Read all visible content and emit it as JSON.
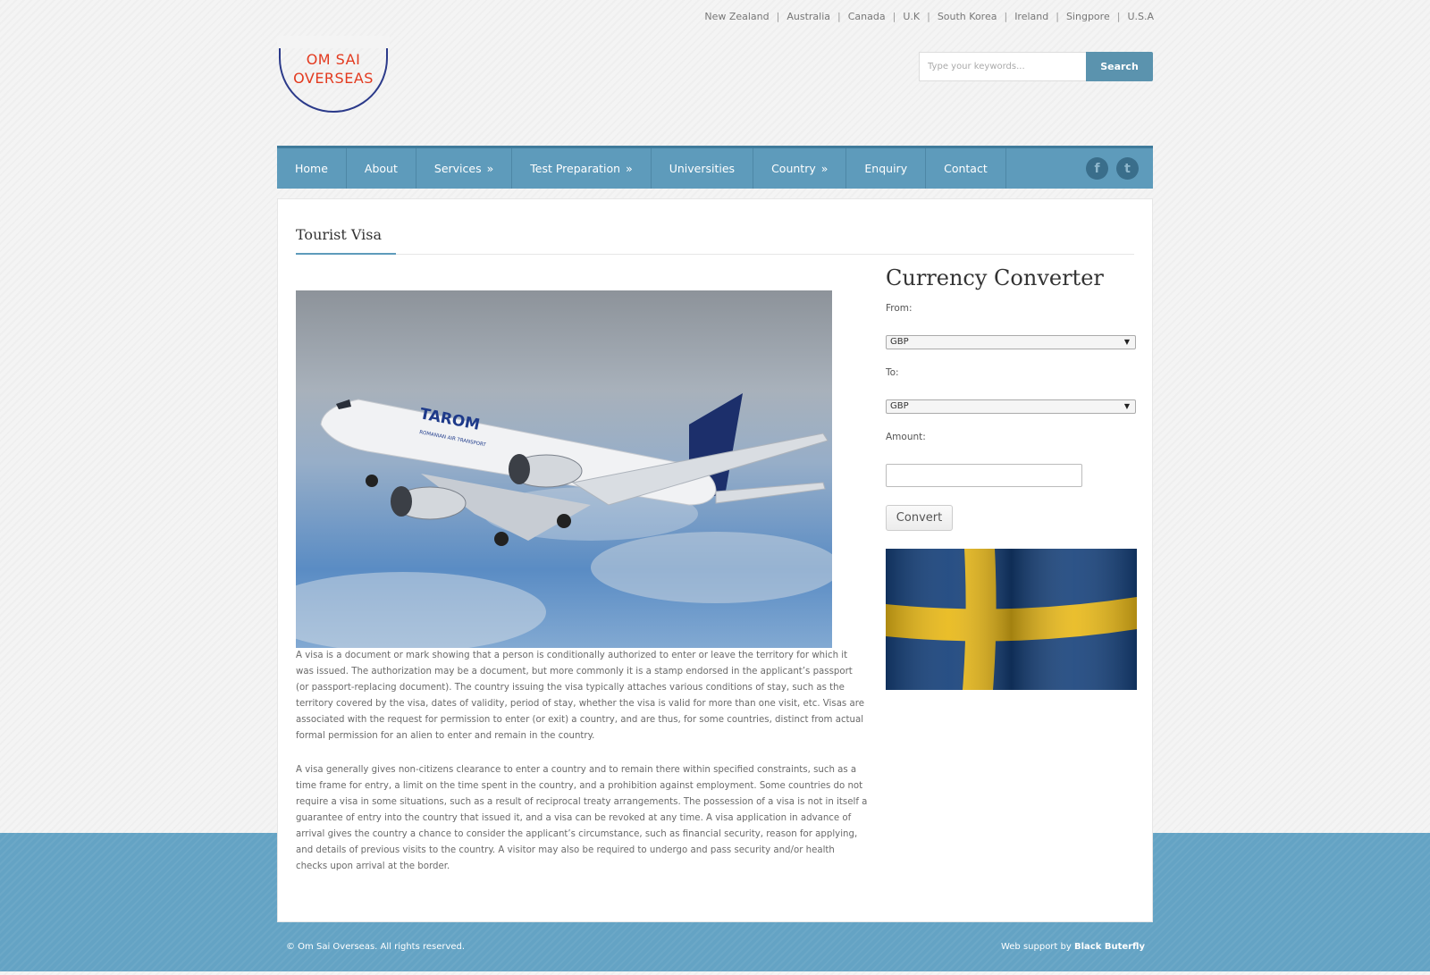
{
  "top_countries": [
    "New Zealand",
    "Australia",
    "Canada",
    "U.K",
    "South Korea",
    "Ireland",
    "Singpore",
    "U.S.A"
  ],
  "logo": {
    "text": "OM SAI\nOVERSEAS"
  },
  "search": {
    "placeholder": "Type your keywords...",
    "button_label": "Search"
  },
  "nav": {
    "items": [
      {
        "label": "Home",
        "arrow": ""
      },
      {
        "label": "About",
        "arrow": ""
      },
      {
        "label": "Services",
        "arrow": "»"
      },
      {
        "label": "Test Preparation",
        "arrow": "»"
      },
      {
        "label": "Universities",
        "arrow": ""
      },
      {
        "label": "Country",
        "arrow": "»"
      },
      {
        "label": "Enquiry",
        "arrow": ""
      },
      {
        "label": "Contact",
        "arrow": ""
      }
    ],
    "social": [
      {
        "icon": "facebook-icon",
        "glyph": "f"
      },
      {
        "icon": "twitter-icon",
        "glyph": "t"
      }
    ]
  },
  "page": {
    "title": "Tourist Visa",
    "paragraphs": [
      "A  visa   is a document or mark showing that a person is conditionally authorized to enter or leave the territory for which it was issued. The authorization may be a document, but more commonly it is a stamp endorsed in the applicant’s  passport  (or passport-replacing document). The country issuing the visa typically attaches various conditions of stay, such as the territory covered by the visa, dates of validity, period of stay, whether the visa is valid for more than one visit, etc. Visas are associated with the request for permission to enter (or exit) a country, and are thus, for some countries, distinct from actual formal permission for an  alien to enter and remain in the country.",
      "A visa generally gives non-citizens clearance to enter a country and to remain there within specified constraints, such as a time frame for entry, a limit on the time spent in the country, and a prohibition against employment. Some countries do not require a visa in some situations, such as a result of reciprocal treaty arrangements. The possession of a visa is not in itself a guarantee of entry into the country that issued it, and a visa can be revoked at any time. A visa application in advance of arrival gives the country a chance to consider the applicant’s circumstance, such as financial security, reason for applying, and details of previous visits to the country. A visitor may also be required to undergo and pass security and/or health checks upon arrival at the border."
    ],
    "hero_image": {
      "airline": "TAROM",
      "subtitle": "ROMANIAN AIR TRANSPORT"
    }
  },
  "converter": {
    "title": "Currency Converter",
    "from_label": "From:",
    "from_value": "GBP",
    "to_label": "To:",
    "to_value": "GBP",
    "amount_label": "Amount:",
    "amount_value": "",
    "button_label": "Convert"
  },
  "footer": {
    "copyright": "© Om Sai Overseas. All rights reserved.",
    "support_prefix": "Web support by ",
    "support_name": "Black Buterfly"
  },
  "colors": {
    "accent": "#5e9bbb",
    "band": "#64a3c4",
    "logo_red": "#e33a1f",
    "logo_navy": "#2b3a8a"
  }
}
